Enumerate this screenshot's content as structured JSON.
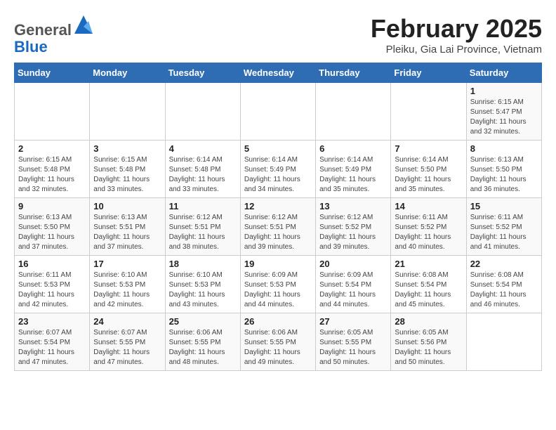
{
  "header": {
    "logo_general": "General",
    "logo_blue": "Blue",
    "month_title": "February 2025",
    "subtitle": "Pleiku, Gia Lai Province, Vietnam"
  },
  "days_of_week": [
    "Sunday",
    "Monday",
    "Tuesday",
    "Wednesday",
    "Thursday",
    "Friday",
    "Saturday"
  ],
  "weeks": [
    [
      {
        "num": "",
        "info": ""
      },
      {
        "num": "",
        "info": ""
      },
      {
        "num": "",
        "info": ""
      },
      {
        "num": "",
        "info": ""
      },
      {
        "num": "",
        "info": ""
      },
      {
        "num": "",
        "info": ""
      },
      {
        "num": "1",
        "info": "Sunrise: 6:15 AM\nSunset: 5:47 PM\nDaylight: 11 hours\nand 32 minutes."
      }
    ],
    [
      {
        "num": "2",
        "info": "Sunrise: 6:15 AM\nSunset: 5:48 PM\nDaylight: 11 hours\nand 32 minutes."
      },
      {
        "num": "3",
        "info": "Sunrise: 6:15 AM\nSunset: 5:48 PM\nDaylight: 11 hours\nand 33 minutes."
      },
      {
        "num": "4",
        "info": "Sunrise: 6:14 AM\nSunset: 5:48 PM\nDaylight: 11 hours\nand 33 minutes."
      },
      {
        "num": "5",
        "info": "Sunrise: 6:14 AM\nSunset: 5:49 PM\nDaylight: 11 hours\nand 34 minutes."
      },
      {
        "num": "6",
        "info": "Sunrise: 6:14 AM\nSunset: 5:49 PM\nDaylight: 11 hours\nand 35 minutes."
      },
      {
        "num": "7",
        "info": "Sunrise: 6:14 AM\nSunset: 5:50 PM\nDaylight: 11 hours\nand 35 minutes."
      },
      {
        "num": "8",
        "info": "Sunrise: 6:13 AM\nSunset: 5:50 PM\nDaylight: 11 hours\nand 36 minutes."
      }
    ],
    [
      {
        "num": "9",
        "info": "Sunrise: 6:13 AM\nSunset: 5:50 PM\nDaylight: 11 hours\nand 37 minutes."
      },
      {
        "num": "10",
        "info": "Sunrise: 6:13 AM\nSunset: 5:51 PM\nDaylight: 11 hours\nand 37 minutes."
      },
      {
        "num": "11",
        "info": "Sunrise: 6:12 AM\nSunset: 5:51 PM\nDaylight: 11 hours\nand 38 minutes."
      },
      {
        "num": "12",
        "info": "Sunrise: 6:12 AM\nSunset: 5:51 PM\nDaylight: 11 hours\nand 39 minutes."
      },
      {
        "num": "13",
        "info": "Sunrise: 6:12 AM\nSunset: 5:52 PM\nDaylight: 11 hours\nand 39 minutes."
      },
      {
        "num": "14",
        "info": "Sunrise: 6:11 AM\nSunset: 5:52 PM\nDaylight: 11 hours\nand 40 minutes."
      },
      {
        "num": "15",
        "info": "Sunrise: 6:11 AM\nSunset: 5:52 PM\nDaylight: 11 hours\nand 41 minutes."
      }
    ],
    [
      {
        "num": "16",
        "info": "Sunrise: 6:11 AM\nSunset: 5:53 PM\nDaylight: 11 hours\nand 42 minutes."
      },
      {
        "num": "17",
        "info": "Sunrise: 6:10 AM\nSunset: 5:53 PM\nDaylight: 11 hours\nand 42 minutes."
      },
      {
        "num": "18",
        "info": "Sunrise: 6:10 AM\nSunset: 5:53 PM\nDaylight: 11 hours\nand 43 minutes."
      },
      {
        "num": "19",
        "info": "Sunrise: 6:09 AM\nSunset: 5:53 PM\nDaylight: 11 hours\nand 44 minutes."
      },
      {
        "num": "20",
        "info": "Sunrise: 6:09 AM\nSunset: 5:54 PM\nDaylight: 11 hours\nand 44 minutes."
      },
      {
        "num": "21",
        "info": "Sunrise: 6:08 AM\nSunset: 5:54 PM\nDaylight: 11 hours\nand 45 minutes."
      },
      {
        "num": "22",
        "info": "Sunrise: 6:08 AM\nSunset: 5:54 PM\nDaylight: 11 hours\nand 46 minutes."
      }
    ],
    [
      {
        "num": "23",
        "info": "Sunrise: 6:07 AM\nSunset: 5:54 PM\nDaylight: 11 hours\nand 47 minutes."
      },
      {
        "num": "24",
        "info": "Sunrise: 6:07 AM\nSunset: 5:55 PM\nDaylight: 11 hours\nand 47 minutes."
      },
      {
        "num": "25",
        "info": "Sunrise: 6:06 AM\nSunset: 5:55 PM\nDaylight: 11 hours\nand 48 minutes."
      },
      {
        "num": "26",
        "info": "Sunrise: 6:06 AM\nSunset: 5:55 PM\nDaylight: 11 hours\nand 49 minutes."
      },
      {
        "num": "27",
        "info": "Sunrise: 6:05 AM\nSunset: 5:55 PM\nDaylight: 11 hours\nand 50 minutes."
      },
      {
        "num": "28",
        "info": "Sunrise: 6:05 AM\nSunset: 5:56 PM\nDaylight: 11 hours\nand 50 minutes."
      },
      {
        "num": "",
        "info": ""
      }
    ]
  ]
}
